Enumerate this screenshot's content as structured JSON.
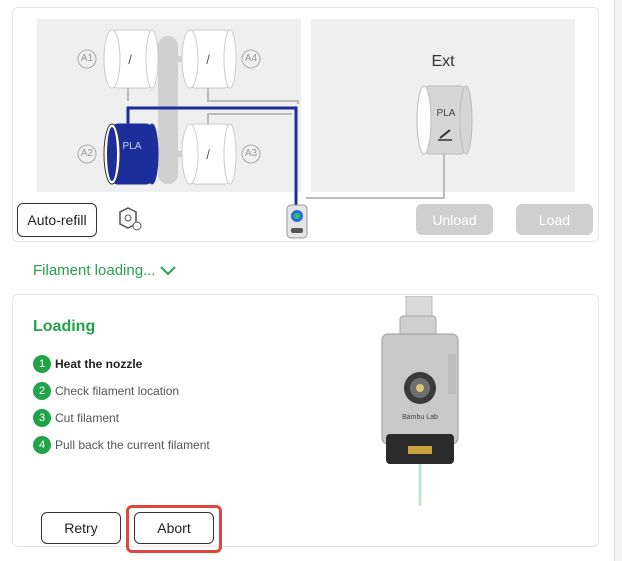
{
  "ams": {
    "slots": [
      {
        "id": "A1",
        "mark": "/"
      },
      {
        "id": "A4",
        "mark": "/"
      },
      {
        "id": "A2",
        "material": "PLA",
        "color": "#1b2e9c"
      },
      {
        "id": "A3",
        "mark": "/"
      }
    ],
    "ext_label": "Ext",
    "ext_material": "PLA",
    "auto_refill_label": "Auto-refill",
    "unload_label": "Unload",
    "load_label": "Load"
  },
  "status": {
    "filament_loading_label": "Filament loading..."
  },
  "steps": {
    "title": "Loading",
    "items": [
      {
        "num": "1",
        "text": "Heat the nozzle",
        "active": true
      },
      {
        "num": "2",
        "text": "Check filament location"
      },
      {
        "num": "3",
        "text": "Cut filament"
      },
      {
        "num": "4",
        "text": "Pull back the current filament"
      }
    ],
    "retry_label": "Retry",
    "abort_label": "Abort"
  },
  "printhead": {
    "brand_text": "Bambu Lab"
  },
  "colors": {
    "accent_green": "#22a34a",
    "filament_blue": "#1b2e9c",
    "highlight_red": "#e0463f"
  }
}
